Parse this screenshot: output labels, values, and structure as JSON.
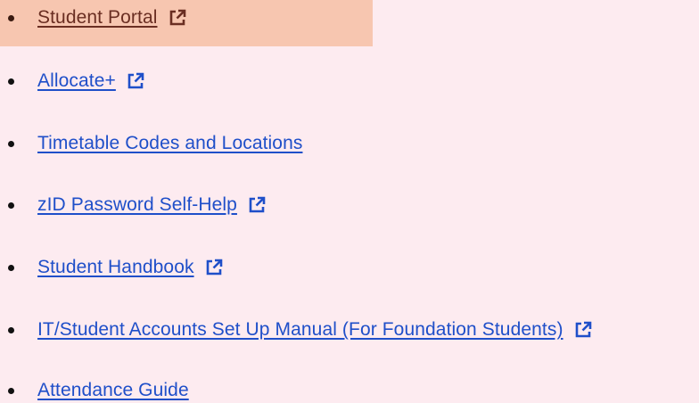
{
  "colors": {
    "page_background": "#fdebf0",
    "highlight_background": "#f7c6b0",
    "link": "#1f4fc9",
    "link_highlighted": "#6a2e22"
  },
  "links": [
    {
      "label": "Student Portal",
      "external": true,
      "highlighted": true,
      "icon": "external-link-icon"
    },
    {
      "label": "Allocate+",
      "external": true,
      "highlighted": false,
      "icon": "external-link-icon"
    },
    {
      "label": "Timetable Codes and Locations",
      "external": false,
      "highlighted": false
    },
    {
      "label": "zID Password Self-Help",
      "external": true,
      "highlighted": false,
      "icon": "external-link-icon"
    },
    {
      "label": "Student Handbook",
      "external": true,
      "highlighted": false,
      "icon": "external-link-icon"
    },
    {
      "label": "IT/Student Accounts Set Up Manual (For Foundation Students)",
      "external": true,
      "highlighted": false,
      "icon": "external-link-icon"
    },
    {
      "label": "Attendance Guide",
      "external": false,
      "highlighted": false
    }
  ]
}
